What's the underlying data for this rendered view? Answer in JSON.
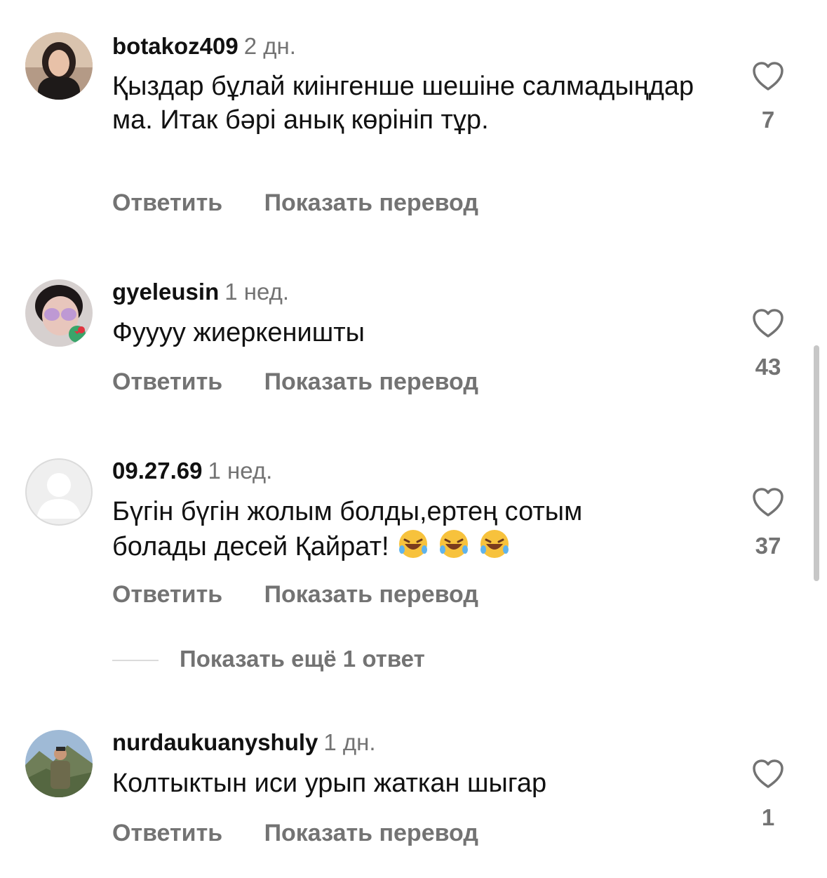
{
  "comments": [
    {
      "username": "botakoz409",
      "time": "2 дн.",
      "text": "Қыздар бұлай киінгенше шешіне салмадыңдар ма. Итак бәрі анық көрініп тұр.",
      "reply_label": "Ответить",
      "translate_label": "Показать перевод",
      "likes": "7"
    },
    {
      "username": "gyeleusin",
      "time": "1 нед.",
      "text": "Фуууу жиеркеништы",
      "reply_label": "Ответить",
      "translate_label": "Показать перевод",
      "likes": "43"
    },
    {
      "username": "09.27.69",
      "time": "1 нед.",
      "text_line1": "Бүгін бүгін жолым болды,ертең сотым",
      "text_line2": "болады десей Қайрат!",
      "emoji": "rolling-on-floor-laughing x3",
      "reply_label": "Ответить",
      "translate_label": "Показать перевод",
      "likes": "37",
      "more_replies": "Показать ещё 1 ответ"
    },
    {
      "username": "nurdaukuanyshuly",
      "time": "1 дн.",
      "text": "Колтыктын иси урып жаткан шыгар",
      "reply_label": "Ответить",
      "translate_label": "Показать перевод",
      "likes": "1"
    }
  ],
  "colors": {
    "text": "#111111",
    "secondary": "#737373",
    "divider": "#dbdbdb"
  }
}
